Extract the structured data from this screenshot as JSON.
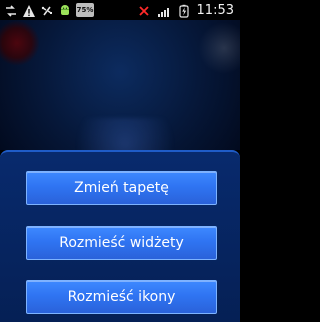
{
  "status_bar": {
    "icons_left": [
      "data-transfer-icon",
      "warning-icon",
      "usb-icon",
      "android-debug-icon"
    ],
    "battery_text": "75%",
    "icons_right": [
      "no-signal-icon",
      "signal-strength-icon",
      "battery-charging-icon"
    ],
    "time": "11:53"
  },
  "menu": {
    "buttons": [
      {
        "label": "Zmień tapetę"
      },
      {
        "label": "Rozmieść widżety"
      },
      {
        "label": "Rozmieść ikony"
      }
    ]
  },
  "colors": {
    "sheet_background": "#062257",
    "sheet_border": "#1f5cc7",
    "button_top": "#3e89ff",
    "button_bottom": "#2a62da",
    "button_border": "#7db3ff",
    "status_text": "#f2f2f2"
  }
}
